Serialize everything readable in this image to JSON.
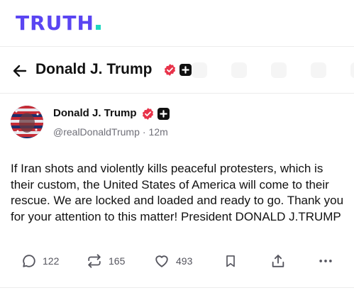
{
  "brand": {
    "logo_text": "TRUTH",
    "colors": {
      "brand": "#5a45f2",
      "dot": "#1ed7c0",
      "verified": "#e8334a"
    }
  },
  "profile_header": {
    "name": "Donald J. Trump",
    "back_icon": "arrow-left-icon"
  },
  "post": {
    "author_name": "Donald J. Trump",
    "handle": "@realDonaldTrump",
    "separator": "·",
    "time": "12m",
    "text": "If Iran shots and violently kills peaceful protesters, which is their custom, the United States of America will come to their rescue. We are locked and loaded and ready to go. Thank you for your attention to this matter! President DONALD J.TRUMP",
    "actions": {
      "replies": "122",
      "retruths": "165",
      "likes": "493"
    }
  }
}
